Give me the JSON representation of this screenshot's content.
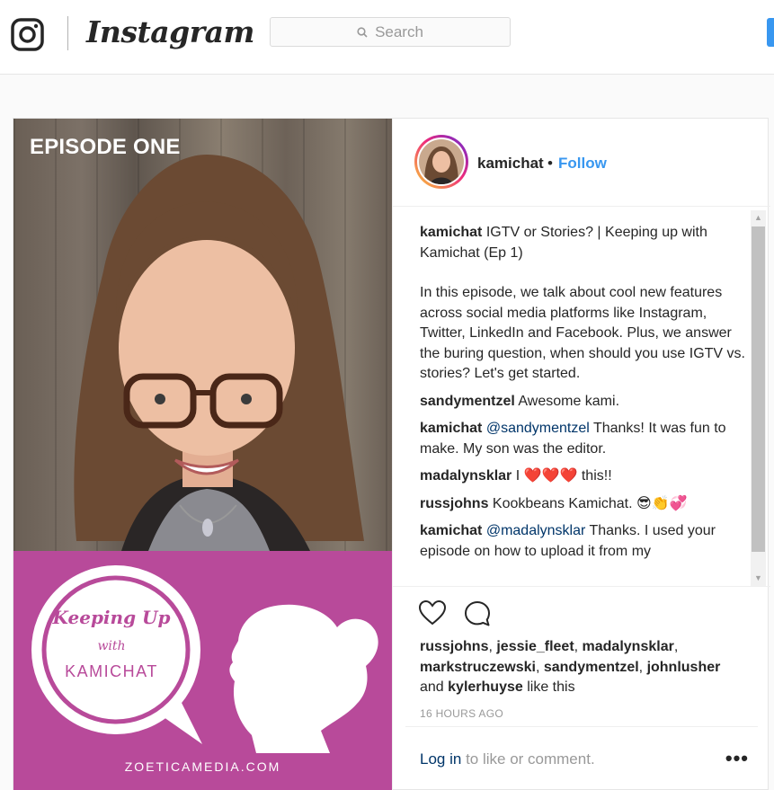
{
  "app": {
    "wordmark": "Instagram"
  },
  "search": {
    "placeholder": "Search"
  },
  "media": {
    "episode_label": "EPISODE ONE",
    "promo": {
      "line1": "Keeping Up",
      "line2": "with",
      "line3": "KAMICHAT",
      "site": "ZOETICAMEDIA.COM"
    },
    "colors": {
      "promo_bg": "#b84a9a"
    }
  },
  "header": {
    "username": "kamichat",
    "dot": "•",
    "follow": "Follow"
  },
  "caption": {
    "user": "kamichat",
    "title": "IGTV or Stories? | Keeping up with Kamichat (Ep 1)",
    "body": "In this episode, we talk about cool new features across social media platforms like Instagram, Twitter, LinkedIn and Facebook. Plus, we answer the buring question, when should you use IGTV vs. stories? Let's get started."
  },
  "comments": [
    {
      "user": "sandymentzel",
      "text": "Awesome kami."
    },
    {
      "user": "kamichat",
      "mention": "@sandymentzel",
      "text": "Thanks! It was fun to make. My son was the editor."
    },
    {
      "user": "madalynsklar",
      "pre": "I",
      "emoji": "❤️❤️❤️",
      "text": "this!!"
    },
    {
      "user": "russjohns",
      "text": "Kookbeans Kamichat.",
      "emoji": "😎👏💞"
    },
    {
      "user": "kamichat",
      "mention": "@madalynsklar",
      "text": "Thanks. I used your episode on how to upload it from my"
    }
  ],
  "likes": {
    "users": [
      "russjohns",
      "jessie_fleet",
      "madalynsklar",
      "markstruczewski",
      "sandymentzel",
      "johnlusher"
    ],
    "and": "and",
    "last": "kylerhuyse",
    "suffix": "like this"
  },
  "time": "16 HOURS AGO",
  "footer": {
    "login": "Log in",
    "rest": "to like or comment.",
    "more": "•••"
  },
  "icons": [
    "instagram-glyph-icon",
    "search-icon",
    "heart-icon",
    "comment-icon",
    "more-icon",
    "scroll-up-icon",
    "scroll-down-icon"
  ]
}
